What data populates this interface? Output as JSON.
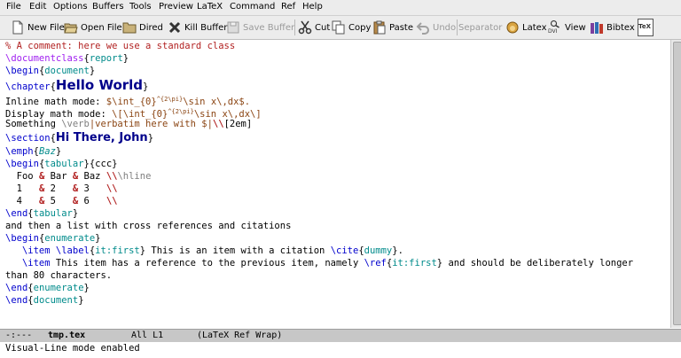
{
  "menubar": {
    "items": [
      "File",
      "Edit",
      "Options",
      "Buffers",
      "Tools",
      "Preview",
      "LaTeX",
      "Command",
      "Ref",
      "Help"
    ]
  },
  "toolbar": {
    "new_file": "New File",
    "open_file": "Open File",
    "dired": "Dired",
    "kill_buffer": "Kill Buffer",
    "save_buffer": "Save Buffer",
    "cut": "Cut",
    "copy": "Copy",
    "paste": "Paste",
    "undo": "Undo",
    "separator": "Separator",
    "latex": "Latex",
    "view": "View",
    "bibtex": "Bibtex",
    "view_dvi_badge": "DVI",
    "tex_badge": "TeX"
  },
  "editor": {
    "comment": "% A comment: here we use a standard class",
    "documentclass_cmd": "\\documentclass",
    "documentclass_arg": "report",
    "begin_cmd": "\\begin",
    "end_cmd": "\\end",
    "env_document": "document",
    "chapter_cmd": "\\chapter",
    "chapter_title": "Hello World",
    "inline_label": "Inline math mode: ",
    "inline_math_a": "$\\int_{0}",
    "inline_math_sup": "^{2\\pi}",
    "inline_math_b": "\\sin x\\,dx$.",
    "display_label": "Display math mode: ",
    "display_math_a": "\\[\\int_{0}",
    "display_math_sup": "^{2\\pi}",
    "display_math_b": "\\sin x\\,dx\\]",
    "something_label": "Something ",
    "verb_cmd": "\\verb",
    "verb_body": "|verbatim here with $|",
    "verb_break": "\\\\",
    "verb_after": "[2em]",
    "section_cmd": "\\section",
    "section_title": "Hi There, John",
    "emph_cmd": "\\emph",
    "emph_arg": "Baz",
    "env_tabular": "tabular",
    "tabular_spec": "{ccc}",
    "row1_a": "  Foo ",
    "row1_b": " Bar ",
    "row1_c": " Baz ",
    "row1_hline": "\\hline",
    "row2_a": "  1   ",
    "row2_b": " 2   ",
    "row2_c": " 3   ",
    "row3_a": "  4   ",
    "row3_b": " 5   ",
    "row3_c": " 6   ",
    "amp": "&",
    "dbs": "\\\\",
    "then_text": "and then a list with cross references and citations",
    "env_enumerate": "enumerate",
    "item_cmd": "\\item",
    "label_cmd": "\\label",
    "label_arg": "it:first",
    "item1_text": " This is an item with a citation ",
    "cite_cmd": "\\cite",
    "cite_arg": "dummy",
    "item1_end": ".",
    "item2_text": " This item has a reference to the previous item, namely ",
    "ref_cmd": "\\ref",
    "ref_arg": "it:first",
    "item2_end": " and should be deliberately longer",
    "item2_wrap": "than 80 characters."
  },
  "modeline": {
    "status": "-:---",
    "buffer": "tmp.tex",
    "position": "All L1",
    "modes": "(LaTeX Ref Wrap)"
  },
  "minibuffer": {
    "message": "Visual-Line mode enabled"
  },
  "colors": {
    "comment": "#b22222",
    "keyword": "#a020f0",
    "builtin": "#0000cd",
    "function": "#008b8b",
    "math": "#8b4513",
    "title": "#00008b"
  }
}
